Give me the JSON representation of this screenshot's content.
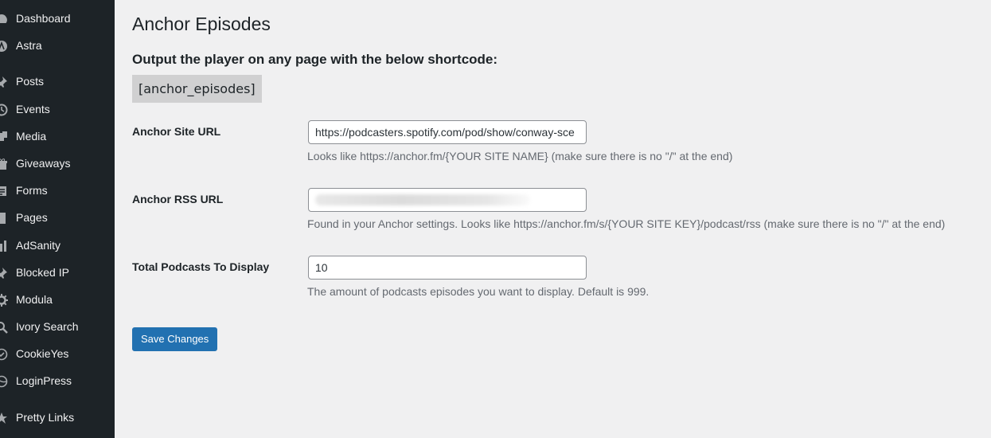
{
  "sidebar": {
    "items": [
      {
        "label": "Dashboard",
        "icon": "dashboard-icon"
      },
      {
        "label": "Astra",
        "icon": "astra-icon"
      },
      {
        "label": "Posts",
        "icon": "pin-icon"
      },
      {
        "label": "Events",
        "icon": "calendar-icon"
      },
      {
        "label": "Media",
        "icon": "media-icon"
      },
      {
        "label": "Giveaways",
        "icon": "gift-icon"
      },
      {
        "label": "Forms",
        "icon": "forms-icon"
      },
      {
        "label": "Pages",
        "icon": "page-icon"
      },
      {
        "label": "AdSanity",
        "icon": "chart-icon"
      },
      {
        "label": "Blocked IP",
        "icon": "pin-icon"
      },
      {
        "label": "Modula",
        "icon": "gear-icon"
      },
      {
        "label": "Ivory Search",
        "icon": "search-icon"
      },
      {
        "label": "CookieYes",
        "icon": "cookie-icon"
      },
      {
        "label": "LoginPress",
        "icon": "loginpress-icon"
      },
      {
        "label": "Pretty Links",
        "icon": "star-icon"
      }
    ]
  },
  "main": {
    "title": "Anchor Episodes",
    "instructions": "Output the player on any page with the below shortcode:",
    "shortcode": "[anchor_episodes]",
    "fields": {
      "site_url": {
        "label": "Anchor Site URL",
        "value": "https://podcasters.spotify.com/pod/show/conway-sce",
        "description": "Looks like https://anchor.fm/{YOUR SITE NAME} (make sure there is no \"/\" at the end)"
      },
      "rss_url": {
        "label": "Anchor RSS URL",
        "value": "",
        "description": "Found in your Anchor settings. Looks like https://anchor.fm/s/{YOUR SITE KEY}/podcast/rss (make sure there is no \"/\" at the end)"
      },
      "total": {
        "label": "Total Podcasts To Display",
        "value": "10",
        "description": "The amount of podcasts episodes you want to display. Default is 999."
      }
    },
    "save_label": "Save Changes"
  }
}
